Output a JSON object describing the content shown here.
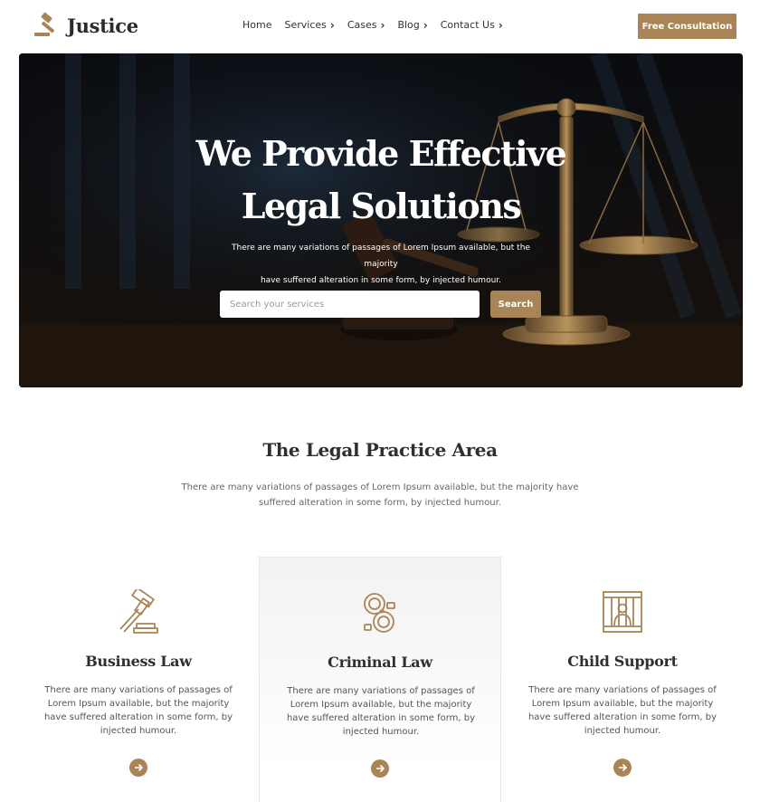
{
  "brand": {
    "name": "Justice",
    "accent": "#a98457"
  },
  "nav": {
    "items": [
      {
        "label": "Home",
        "has_dropdown": false
      },
      {
        "label": "Services",
        "has_dropdown": true
      },
      {
        "label": "Cases",
        "has_dropdown": true
      },
      {
        "label": "Blog",
        "has_dropdown": true
      },
      {
        "label": "Contact Us",
        "has_dropdown": true
      }
    ],
    "cta_label": "Free Consultation"
  },
  "hero": {
    "title_line1": "We Provide Effective",
    "title_line2": "Legal Solutions",
    "subtitle_line1": "There are many variations of passages of Lorem Ipsum available, but the majority",
    "subtitle_line2": "have suffered alteration in some form, by injected humour.",
    "search_placeholder": "Search your services",
    "search_value": "",
    "search_button": "Search",
    "background_icon": "scales-of-justice-and-gavel"
  },
  "practice": {
    "title": "The Legal Practice Area",
    "subtitle_line1": "There are many variations of passages of Lorem Ipsum available, but the majority have",
    "subtitle_line2": "suffered alteration in some form, by injected humour.",
    "cards": [
      {
        "title": "Business Law",
        "icon": "gavel-icon",
        "text": "There are many variations of passages of Lorem Ipsum available, but the majority have suffered alteration in some form, by injected humour."
      },
      {
        "title": "Criminal Law",
        "icon": "handcuffs-icon",
        "text": "There are many variations of passages of Lorem Ipsum available, but the majority have suffered alteration in some form, by injected humour."
      },
      {
        "title": "Child Support",
        "icon": "prison-cell-icon",
        "text": "There are many variations of passages of Lorem Ipsum available, but the majority have suffered alteration in some form, by injected humour."
      }
    ]
  }
}
